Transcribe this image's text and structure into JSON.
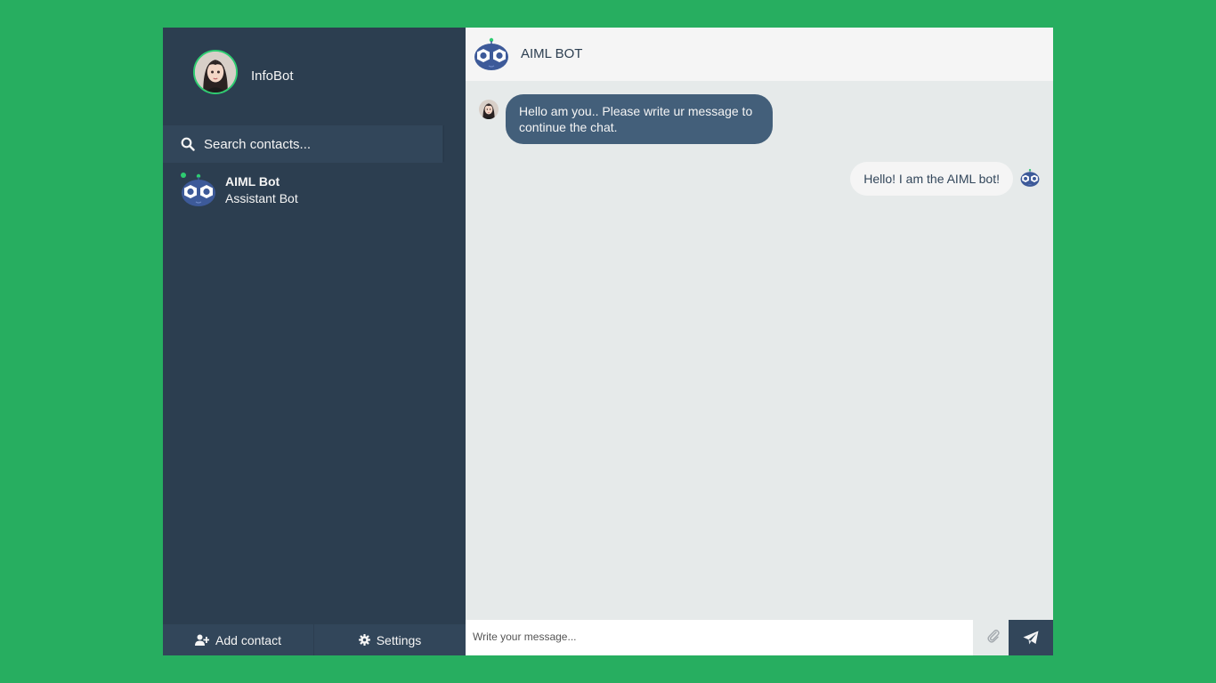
{
  "profile": {
    "name": "InfoBot"
  },
  "search": {
    "placeholder": "Search contacts..."
  },
  "contacts": [
    {
      "name": "AIML Bot",
      "preview": "Assistant Bot"
    }
  ],
  "bottom_bar": {
    "add_contact_label": "Add contact",
    "settings_label": "Settings"
  },
  "chat_header": {
    "name": "AIML BOT"
  },
  "messages": [
    {
      "type": "sent",
      "text": "Hello am you.. Please write ur message to continue the chat."
    },
    {
      "type": "replies",
      "text": "Hello! I am the AIML bot!"
    }
  ],
  "composer": {
    "placeholder": "Write your message..."
  },
  "colors": {
    "background": "#27ae60",
    "sidebar": "#2c3e50",
    "sent_bubble": "#435f7a",
    "reply_bubble": "#f5f5f5",
    "online": "#2ecc71"
  }
}
